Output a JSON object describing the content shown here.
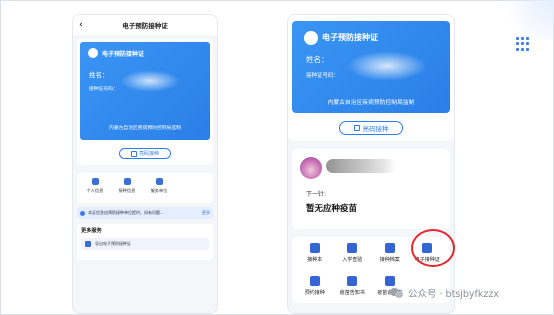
{
  "left_phone": {
    "header_title": "电子预防接种证",
    "back_icon": "chevron-left-icon",
    "card": {
      "title": "电子预防接种证",
      "name_label": "姓名：",
      "number_label": "接种证号码：",
      "issuer": "内蒙古自治区疾病预防控制局监制"
    },
    "qr_button": "亮码接种",
    "icons": [
      {
        "label": "个人信息",
        "icon": "person-icon"
      },
      {
        "label": "接种信息",
        "icon": "syringe-icon"
      },
      {
        "label": "服务单位",
        "icon": "building-icon"
      }
    ],
    "notice_text": "本证信息由预防接种单位提供，如有问题...",
    "notice_more": "更多",
    "more_services_title": "更多服务",
    "more_services_item": "导出电子预防接种证"
  },
  "right_phone": {
    "card": {
      "title": "电子预防接种证",
      "name_label": "姓名：",
      "number_label": "接种证号码：",
      "issuer": "内蒙古自治区疾病预防控制局监制"
    },
    "qr_button": "亮码接种",
    "next_label": "下一针:",
    "next_vaccine": "暂无应种疫苗",
    "grid": [
      {
        "label": "接种本",
        "icon": "book-icon"
      },
      {
        "label": "入学查验",
        "icon": "school-icon"
      },
      {
        "label": "接种档案",
        "icon": "file-icon"
      },
      {
        "label": "电子接种证",
        "icon": "id-card-icon"
      },
      {
        "label": "预约接种",
        "icon": "calendar-icon"
      },
      {
        "label": "疫苗告知书",
        "icon": "document-icon"
      },
      {
        "label": "疫苗说明书",
        "icon": "manual-icon"
      }
    ]
  },
  "watermark": {
    "label": "公众号 · btsjbyfkzzx"
  },
  "colors": {
    "card_blue": "#2f8cf0",
    "accent_blue": "#2f7cf0",
    "highlight_red": "#e3272b"
  }
}
